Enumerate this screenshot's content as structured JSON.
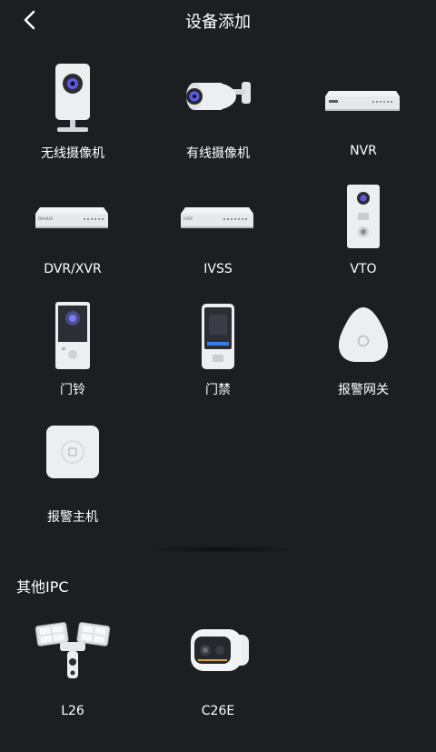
{
  "header": {
    "title": "设备添加",
    "back_icon": "chevron-left-icon"
  },
  "devices": [
    {
      "label": "无线摄像机",
      "icon": "wireless-camera-icon"
    },
    {
      "label": "有线摄像机",
      "icon": "bullet-camera-icon"
    },
    {
      "label": "NVR",
      "icon": "nvr-icon"
    },
    {
      "label": "DVR/XVR",
      "icon": "dvr-icon"
    },
    {
      "label": "IVSS",
      "icon": "ivss-icon"
    },
    {
      "label": "VTO",
      "icon": "vto-icon"
    },
    {
      "label": "门铃",
      "icon": "doorbell-icon"
    },
    {
      "label": "门禁",
      "icon": "access-control-icon"
    },
    {
      "label": "报警网关",
      "icon": "alarm-gateway-icon"
    },
    {
      "label": "报警主机",
      "icon": "alarm-hub-icon"
    }
  ],
  "other_ipc": {
    "title": "其他IPC",
    "items": [
      {
        "label": "L26",
        "icon": "floodlight-camera-icon"
      },
      {
        "label": "C26E",
        "icon": "c26e-camera-icon"
      }
    ]
  },
  "device_silkscreen": {
    "dvr": "DAHUA",
    "ivss": "IVSS"
  },
  "colors": {
    "background": "#1c1e22",
    "text": "#ffffff"
  }
}
